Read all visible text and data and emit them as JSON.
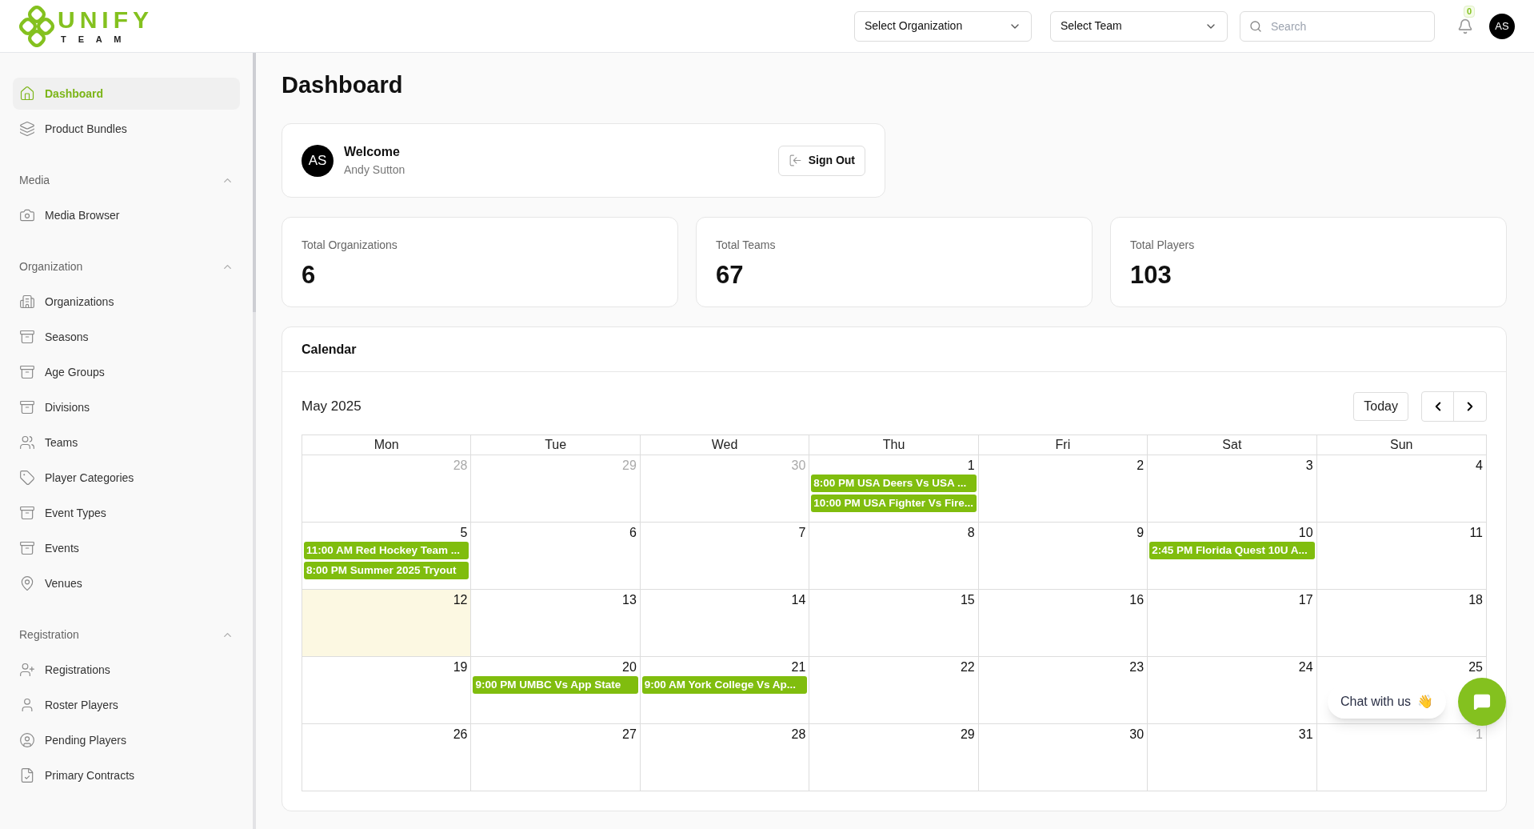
{
  "logo": {
    "word": "UNIFY",
    "subword": "T E A M"
  },
  "header": {
    "selects": [
      "Select Organization",
      "Select Team"
    ],
    "search": {
      "placeholder": "Search"
    },
    "notifications": "0",
    "avatar": "AS"
  },
  "sidebar": {
    "sections": [
      {
        "items": [
          {
            "label": "Dashboard",
            "selected": true
          },
          {
            "label": "Product Bundles",
            "selected": false
          }
        ]
      },
      {
        "title": "Media",
        "expanded": true,
        "items": [
          {
            "label": "Media Browser",
            "selected": false
          }
        ]
      },
      {
        "title": "Organization",
        "expanded": true,
        "items": [
          {
            "label": "Organizations",
            "selected": false
          },
          {
            "label": "Seasons",
            "selected": false
          },
          {
            "label": "Age Groups",
            "selected": false
          },
          {
            "label": "Divisions",
            "selected": false
          },
          {
            "label": "Teams",
            "selected": false
          },
          {
            "label": "Player Categories",
            "selected": false
          },
          {
            "label": "Event Types",
            "selected": false
          },
          {
            "label": "Events",
            "selected": false
          },
          {
            "label": "Venues",
            "selected": false
          }
        ]
      },
      {
        "title": "Registration",
        "expanded": true,
        "items": [
          {
            "label": "Registrations",
            "selected": false
          },
          {
            "label": "Roster Players",
            "selected": false
          },
          {
            "label": "Pending Players",
            "selected": false
          },
          {
            "label": "Primary Contracts",
            "selected": false
          }
        ]
      }
    ]
  },
  "page_title": "Dashboard",
  "welcome": {
    "avatar": "AS",
    "title": "Welcome",
    "name": "Andy Sutton",
    "button": "Sign Out"
  },
  "stats": [
    {
      "label": "Total Organizations",
      "value": "6"
    },
    {
      "label": "Total Teams",
      "value": "67"
    },
    {
      "label": "Total Players",
      "value": "103"
    }
  ],
  "calendar": {
    "title": "Calendar",
    "month": "May 2025",
    "today_button": "Today",
    "weekdays": [
      "Mon",
      "Tue",
      "Wed",
      "Thu",
      "Fri",
      "Sat",
      "Sun"
    ],
    "weeks": [
      [
        {
          "day": "28",
          "muted": true
        },
        {
          "day": "29",
          "muted": true
        },
        {
          "day": "30",
          "muted": true
        },
        {
          "day": "1",
          "muted": false,
          "events": [
            "8:00 PM USA Deers Vs USA ...",
            "10:00 PM USA Fighter Vs Fire..."
          ]
        },
        {
          "day": "2",
          "muted": false
        },
        {
          "day": "3",
          "muted": false
        },
        {
          "day": "4",
          "muted": false
        }
      ],
      [
        {
          "day": "5",
          "muted": false,
          "events": [
            "11:00 AM Red Hockey Team ...",
            "8:00 PM Summer 2025 Tryout"
          ]
        },
        {
          "day": "6",
          "muted": false
        },
        {
          "day": "7",
          "muted": false
        },
        {
          "day": "8",
          "muted": false
        },
        {
          "day": "9",
          "muted": false
        },
        {
          "day": "10",
          "muted": false,
          "events": [
            "2:45 PM Florida Quest 10U A..."
          ]
        },
        {
          "day": "11",
          "muted": false
        }
      ],
      [
        {
          "day": "12",
          "muted": false,
          "today": true
        },
        {
          "day": "13",
          "muted": false
        },
        {
          "day": "14",
          "muted": false
        },
        {
          "day": "15",
          "muted": false
        },
        {
          "day": "16",
          "muted": false
        },
        {
          "day": "17",
          "muted": false
        },
        {
          "day": "18",
          "muted": false
        }
      ],
      [
        {
          "day": "19",
          "muted": false
        },
        {
          "day": "20",
          "muted": false,
          "events": [
            "9:00 PM UMBC Vs App State"
          ]
        },
        {
          "day": "21",
          "muted": false,
          "events": [
            "9:00 AM York College Vs Ap..."
          ]
        },
        {
          "day": "22",
          "muted": false
        },
        {
          "day": "23",
          "muted": false
        },
        {
          "day": "24",
          "muted": false
        },
        {
          "day": "25",
          "muted": false
        }
      ],
      [
        {
          "day": "26",
          "muted": false
        },
        {
          "day": "27",
          "muted": false
        },
        {
          "day": "28",
          "muted": false
        },
        {
          "day": "29",
          "muted": false
        },
        {
          "day": "30",
          "muted": false
        },
        {
          "day": "31",
          "muted": false
        },
        {
          "day": "1",
          "muted": true
        }
      ]
    ]
  },
  "chat": {
    "label": "Chat with us",
    "emoji": "👋"
  }
}
